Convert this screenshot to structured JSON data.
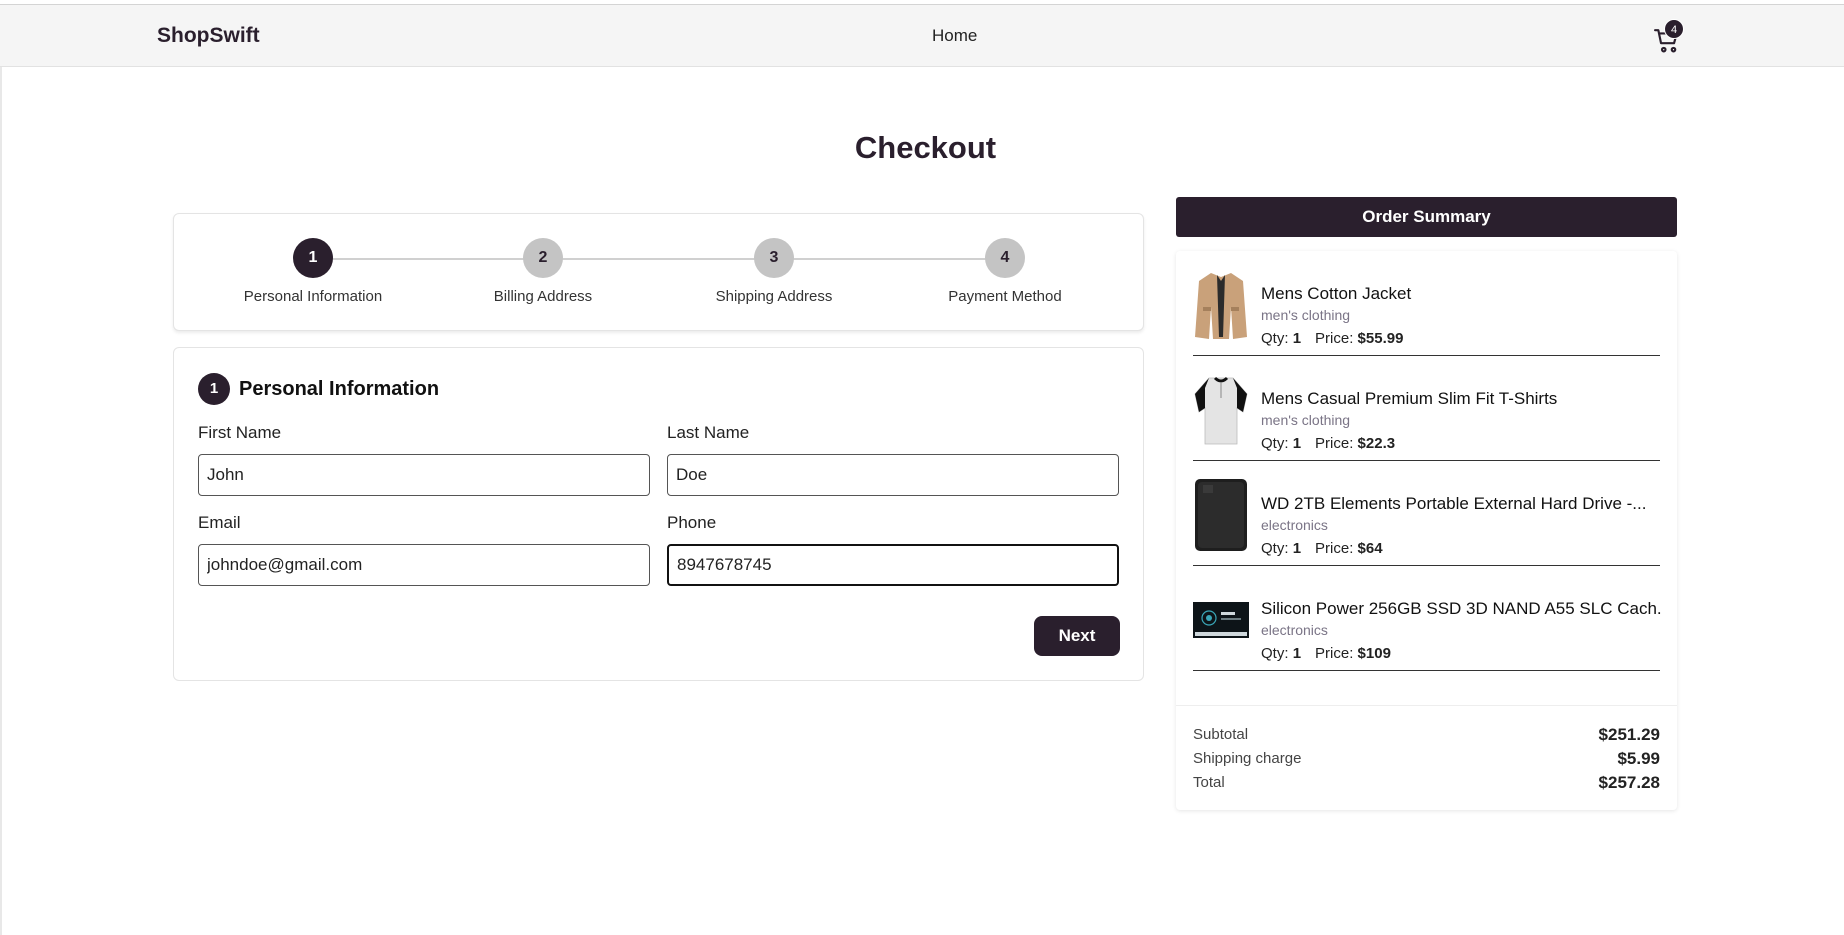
{
  "header": {
    "logo": "ShopSwift",
    "nav_home": "Home",
    "cart_count": "4"
  },
  "page_title": "Checkout",
  "stepper": {
    "steps": [
      {
        "number": "1",
        "label": "Personal Information",
        "active": true
      },
      {
        "number": "2",
        "label": "Billing Address",
        "active": false
      },
      {
        "number": "3",
        "label": "Shipping Address",
        "active": false
      },
      {
        "number": "4",
        "label": "Payment Method",
        "active": false
      }
    ]
  },
  "form": {
    "number": "1",
    "title": "Personal Information",
    "fields": {
      "first_name": {
        "label": "First Name",
        "value": "John"
      },
      "last_name": {
        "label": "Last Name",
        "value": "Doe"
      },
      "email": {
        "label": "Email",
        "value": "johndoe@gmail.com"
      },
      "phone": {
        "label": "Phone",
        "value": "8947678745"
      }
    },
    "next_label": "Next"
  },
  "summary": {
    "title": "Order Summary",
    "qty_label": "Qty:",
    "price_label": "Price:",
    "items": [
      {
        "name": "Mens Cotton Jacket",
        "category": "men's clothing",
        "qty": "1",
        "price": "$55.99",
        "icon": "jacket-image"
      },
      {
        "name": "Mens Casual Premium Slim Fit T-Shirts",
        "category": "men's clothing",
        "qty": "1",
        "price": "$22.3",
        "icon": "tshirt-image"
      },
      {
        "name": "WD 2TB Elements Portable External Hard Drive -...",
        "category": "electronics",
        "qty": "1",
        "price": "$64",
        "icon": "hard-drive-image"
      },
      {
        "name": "Silicon Power 256GB SSD 3D NAND A55 SLC Cach...",
        "category": "electronics",
        "qty": "1",
        "price": "$109",
        "icon": "ssd-image"
      }
    ],
    "subtotal_label": "Subtotal",
    "subtotal": "$251.29",
    "shipping_label": "Shipping charge",
    "shipping": "$5.99",
    "total_label": "Total",
    "total": "$257.28"
  },
  "colors": {
    "brand": "#2a1f2d",
    "inactive_step": "#c4c4c4",
    "header_bg": "#f5f5f5"
  }
}
